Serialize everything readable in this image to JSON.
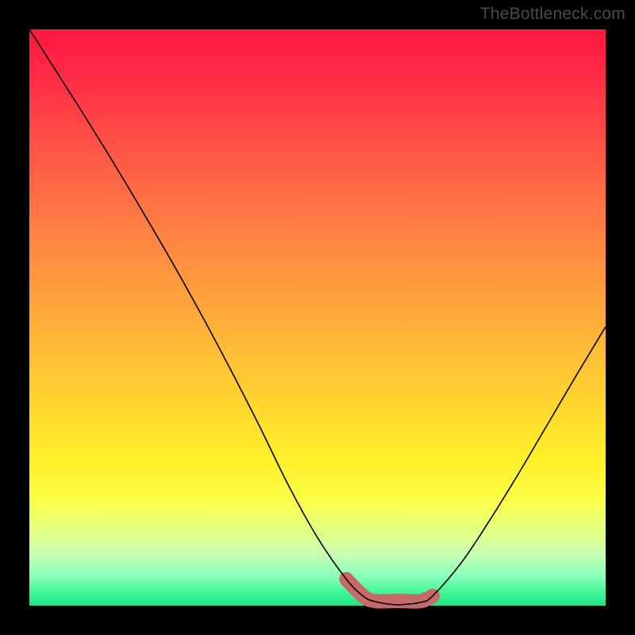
{
  "attribution": "TheBottleneck.com",
  "colors": {
    "frame": "#000000",
    "curve": "#000000",
    "optimal_band": "#c86969",
    "gradient_top": "#ff173f",
    "gradient_bottom": "#22e28a"
  },
  "chart_data": {
    "type": "line",
    "title": "",
    "xlabel": "",
    "ylabel": "",
    "xlim": [
      0,
      100
    ],
    "ylim": [
      0,
      100
    ],
    "note": "Bottleneck/mismatch curve. x = relative component class (0–100), y = bottleneck percentage (0 = ideal match, 100 = severe bottleneck). Values estimated from plot shape; no axis ticks visible.",
    "series": [
      {
        "name": "bottleneck_percent",
        "x": [
          0,
          5,
          10,
          15,
          20,
          25,
          30,
          35,
          40,
          45,
          50,
          55,
          58,
          60,
          63,
          65,
          68,
          70,
          75,
          80,
          85,
          90,
          95,
          100
        ],
        "values": [
          100,
          92.2,
          84.3,
          76.2,
          67.8,
          59.2,
          50.2,
          40.8,
          31.0,
          20.8,
          11.8,
          4.6,
          1.6,
          0.7,
          0.2,
          0.2,
          0.6,
          1.7,
          7.5,
          15.0,
          23.1,
          31.6,
          40.1,
          48.4
        ]
      }
    ],
    "optimal_range_x": [
      55,
      71
    ],
    "annotations": []
  }
}
